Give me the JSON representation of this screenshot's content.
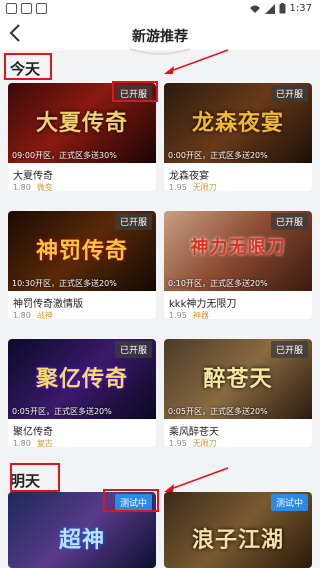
{
  "status_bar": {
    "time": "1:37"
  },
  "header": {
    "back_icon": "back-chevron-icon",
    "title": "新游推荐"
  },
  "sections": {
    "today": {
      "label": "今天"
    },
    "tomorrow": {
      "label": "明天"
    }
  },
  "cards": [
    {
      "banner_text": "大夏传奇",
      "badge": "已开服",
      "open_time": "09:00开区，正式区多送30%",
      "name": "大夏传奇",
      "size": "1.80",
      "tag": "微变"
    },
    {
      "banner_text": "龙森夜宴",
      "badge": "已开服",
      "open_time": "0:00开区，正式区多送20%",
      "name": "龙森夜宴",
      "size": "1.95",
      "tag": "无限刀"
    },
    {
      "banner_text": "神罚传奇",
      "badge": "已开服",
      "open_time": "10:30开区，正式区多送20%",
      "name": "神罚传奇激情版",
      "size": "1.80",
      "tag": "战神"
    },
    {
      "banner_text": "神力无限刀",
      "badge": "已开服",
      "open_time": "0:10开区，正式区多送20%",
      "name": "kkk神力无限刀",
      "size": "1.95",
      "tag": "神器"
    },
    {
      "banner_text": "聚亿传奇",
      "badge": "已开服",
      "open_time": "0:05开区，正式区多送20%",
      "name": "聚亿传奇",
      "size": "1.80",
      "tag": "复古"
    },
    {
      "banner_text": "醉苍天",
      "badge": "已开服",
      "open_time": "0:05开区，正式区多送20%",
      "name": "乘风醉苍天",
      "size": "1.95",
      "tag": "无限刀"
    },
    {
      "banner_text": "超神",
      "badge": "测试中",
      "open_time": "",
      "name": "",
      "size": "",
      "tag": ""
    },
    {
      "banner_text": "浪子江湖",
      "badge": "测试中",
      "open_time": "",
      "name": "",
      "size": "",
      "tag": ""
    }
  ],
  "colors": {
    "annotation_red": "#e0141c",
    "test_badge_blue": "#2a8ae8",
    "tag_gold": "#d09a2a"
  }
}
